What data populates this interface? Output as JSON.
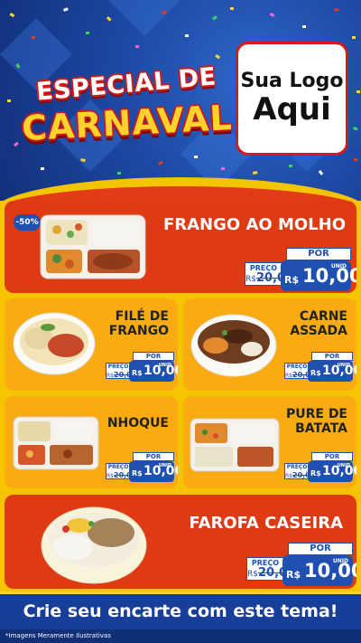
{
  "header": {
    "title_line1": "ESPECIAL DE",
    "title_line2": "CARNAVAL",
    "logo_line1": "Sua Logo",
    "logo_line2": "Aqui"
  },
  "colors": {
    "red": "#de3a14",
    "yellow": "#f9ab11",
    "blue": "#1f4fb0",
    "gold": "#ffd22e"
  },
  "items": [
    {
      "name": "FRANGO AO MOLHO",
      "badge": "-50%",
      "preco_label": "PREÇO",
      "old_prefix": "R$",
      "old_price": "20,00",
      "por_label": "POR",
      "currency": "R$",
      "price": "10,00",
      "unit": "UNID"
    },
    {
      "name_line1": "FILÉ DE",
      "name_line2": "FRANGO",
      "preco_label": "PREÇO",
      "old_prefix": "R$",
      "old_price": "20,00",
      "por_label": "POR",
      "currency": "R$",
      "price": "10,00",
      "unit": "UNID"
    },
    {
      "name_line1": "CARNE",
      "name_line2": "ASSADA",
      "preco_label": "PREÇO",
      "old_prefix": "R$",
      "old_price": "20,00",
      "por_label": "POR",
      "currency": "R$",
      "price": "10,00",
      "unit": "UNID"
    },
    {
      "name": "NHOQUE",
      "preco_label": "PREÇO",
      "old_prefix": "R$",
      "old_price": "20,00",
      "por_label": "POR",
      "currency": "R$",
      "price": "10,00",
      "unit": "UNID"
    },
    {
      "name_line1": "PURE DE",
      "name_line2": "BATATA",
      "preco_label": "PREÇO",
      "old_prefix": "R$",
      "old_price": "20,00",
      "por_label": "POR",
      "currency": "R$",
      "price": "10,00",
      "unit": "UNID"
    },
    {
      "name": "FAROFA CASEIRA",
      "preco_label": "PREÇO",
      "old_prefix": "R$",
      "old_price": "20,00",
      "por_label": "POR",
      "currency": "R$",
      "price": "10,00",
      "unit": "UNID"
    }
  ],
  "cta": "Crie seu encarte com este tema!",
  "footer": "*Imagens Meramente Ilustrativas"
}
